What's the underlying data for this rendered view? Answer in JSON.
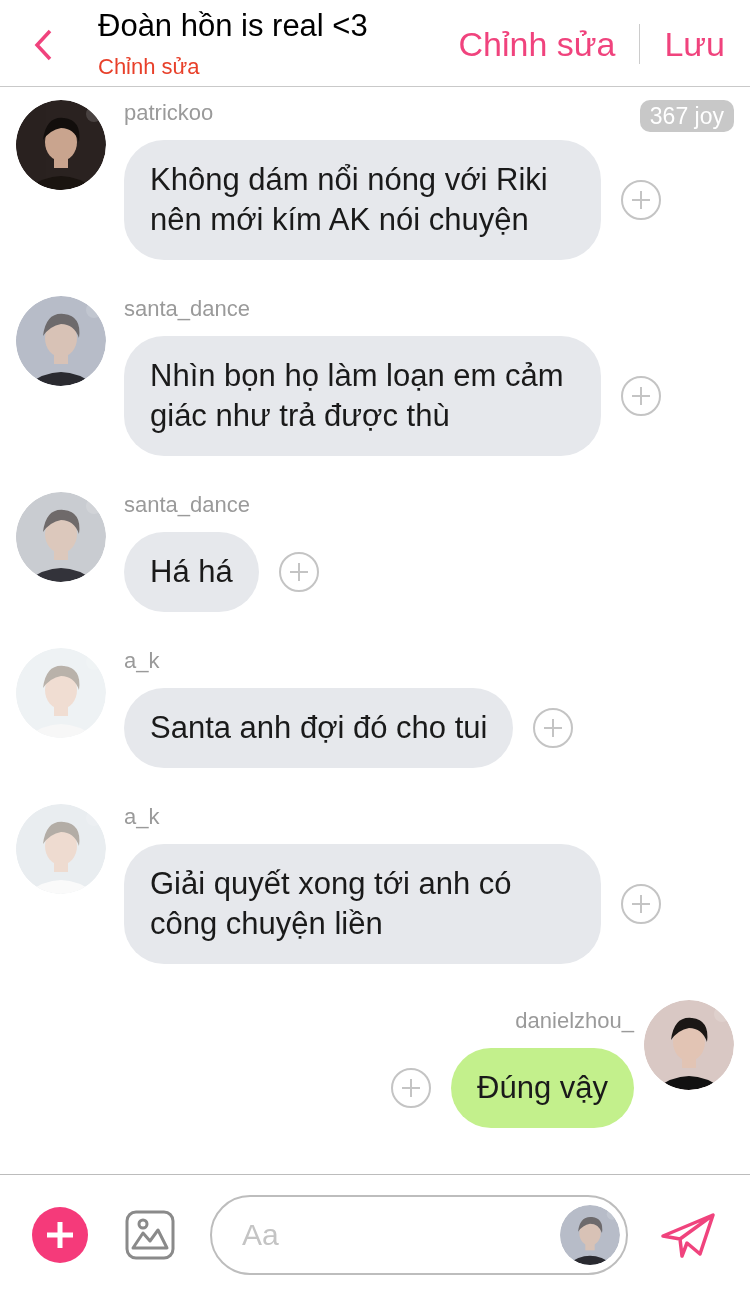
{
  "header": {
    "title": "Đoàn hồn is real <3",
    "subtitle": "Chỉnh sửa",
    "actions": [
      "Chỉnh sửa",
      "Lưu"
    ]
  },
  "messages": [
    {
      "kind": "incoming",
      "sender": "patrickoo",
      "text": "Không dám nổi nóng với Riki nên mới kím AK nói chuyện",
      "badge": "367 joy"
    },
    {
      "kind": "incoming",
      "sender": "santa_dance",
      "text": "Nhìn bọn họ làm loạn em cảm giác như trả được thù"
    },
    {
      "kind": "incoming",
      "sender": "santa_dance",
      "text": "Há há"
    },
    {
      "kind": "incoming",
      "sender": "a_k",
      "text": "Santa anh đợi đó cho tui"
    },
    {
      "kind": "incoming",
      "sender": "a_k",
      "text": "Giải quyết xong tới anh có công chuyện liền"
    },
    {
      "kind": "outgoing",
      "sender": "danielzhou_",
      "text": "Đúng vậy"
    }
  ],
  "composer": {
    "placeholder": "Aa"
  }
}
